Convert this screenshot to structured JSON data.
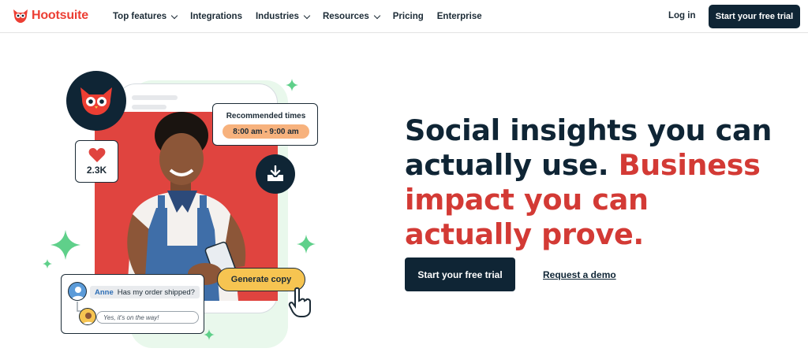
{
  "brand": {
    "name": "Hootsuite",
    "color": "#ec3e33"
  },
  "nav": {
    "items": [
      {
        "label": "Top features",
        "dropdown": true
      },
      {
        "label": "Integrations",
        "dropdown": false
      },
      {
        "label": "Industries",
        "dropdown": true
      },
      {
        "label": "Resources",
        "dropdown": true
      },
      {
        "label": "Pricing",
        "dropdown": false
      },
      {
        "label": "Enterprise",
        "dropdown": false
      }
    ],
    "login": "Log in",
    "trial": "Start your free trial"
  },
  "hero": {
    "headline_dark": "Social insights you can actually use.",
    "headline_red": "Business impact you can actually prove.",
    "cta_primary": "Start your free trial",
    "cta_secondary": "Request a demo"
  },
  "illustration": {
    "likes": "2.3K",
    "recommended_title": "Recommended times",
    "recommended_value": "8:00 am - 9:00 am",
    "generate_button": "Generate copy",
    "chat_name": "Anne",
    "chat_message": "Has my order shipped?",
    "chat_reply": "Yes, it's on the way!"
  },
  "colors": {
    "navy": "#0f2535",
    "red": "#d33a35",
    "accent_orange": "#f7b27d",
    "accent_yellow": "#f6c451",
    "sparkle_green": "#5fd08a"
  }
}
